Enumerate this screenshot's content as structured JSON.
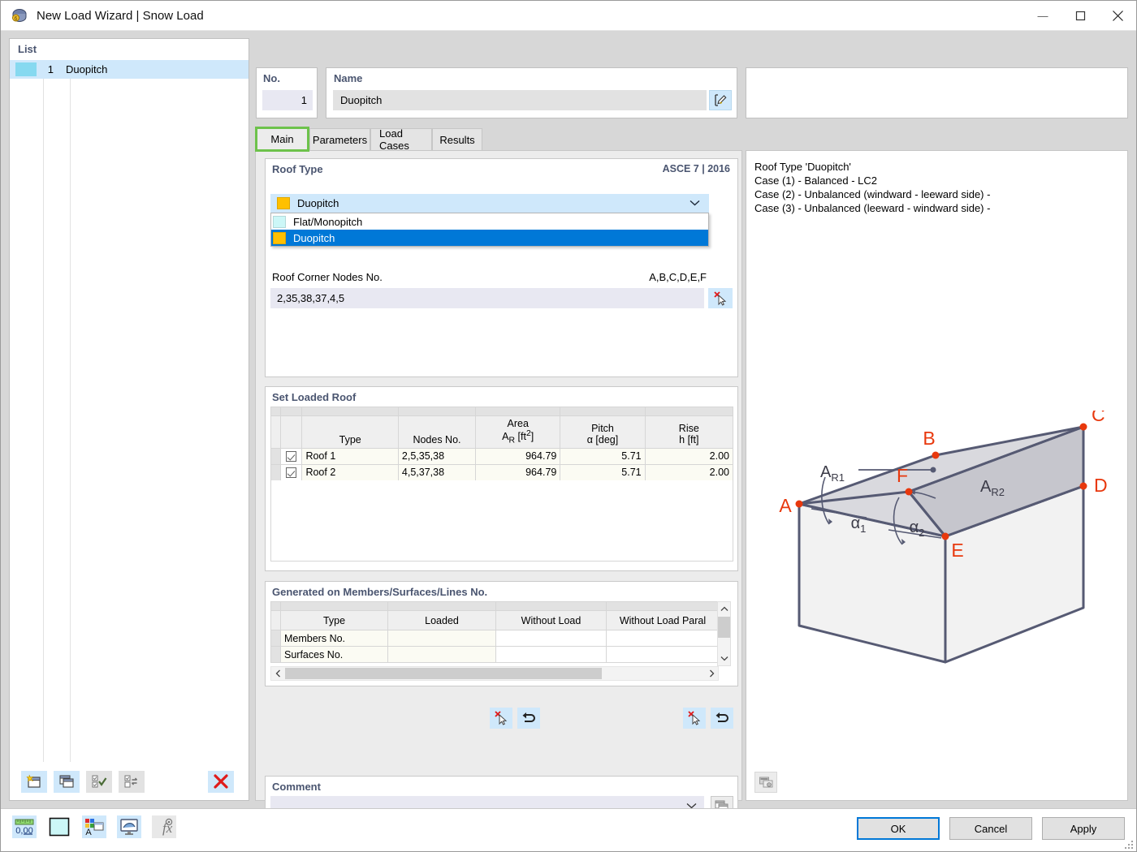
{
  "window": {
    "title": "New Load Wizard | Snow Load",
    "app_icon": "load-wizard-icon",
    "minimize": "—",
    "maximize": "□",
    "close": "✕"
  },
  "list_panel": {
    "caption": "List",
    "rows": [
      {
        "color": "#86d9f0",
        "no": "1",
        "name": "Duopitch"
      }
    ],
    "toolbar": [
      {
        "name": "new-item-button",
        "icon": "new-window-icon"
      },
      {
        "name": "copy-item-button",
        "icon": "copy-window-icon"
      },
      {
        "name": "select-all-button",
        "icon": "check-all-icon"
      },
      {
        "name": "invert-selection-button",
        "icon": "invert-check-icon"
      },
      {
        "name": "delete-item-button",
        "icon": "red-x-icon"
      }
    ]
  },
  "no_panel": {
    "caption": "No.",
    "value": "1"
  },
  "name_panel": {
    "caption": "Name",
    "value": "Duopitch",
    "edit_icon": "edit-pencil-icon"
  },
  "tabs": [
    {
      "label": "Main",
      "active": true
    },
    {
      "label": "Parameters",
      "active": false
    },
    {
      "label": "Load Cases",
      "active": false
    },
    {
      "label": "Results",
      "active": false
    }
  ],
  "roof_type": {
    "title": "Roof Type",
    "standard": "ASCE 7 | 2016",
    "selected": {
      "label": "Duopitch",
      "color": "#ffc000"
    },
    "options": [
      {
        "label": "Flat/Monopitch",
        "color": "#ccf7f7",
        "selected": false
      },
      {
        "label": "Duopitch",
        "color": "#ffc000",
        "selected": true
      }
    ],
    "nodes_label": "Roof Corner Nodes No.",
    "nodes_hint": "A,B,C,D,E,F",
    "nodes_value": "2,35,38,37,4,5",
    "pick_icon": "pick-cursor-icon"
  },
  "loaded_roof": {
    "title": "Set Loaded Roof",
    "columns": [
      "Type",
      "Nodes No.",
      "Area",
      "Pitch",
      "Rise"
    ],
    "column_units": [
      "",
      "",
      "AR [ft2]",
      "α [deg]",
      "h [ft]"
    ],
    "rows": [
      {
        "checked": true,
        "type": "Roof 1",
        "nodes": "2,5,35,38",
        "area": "964.79",
        "pitch": "5.71",
        "rise": "2.00"
      },
      {
        "checked": true,
        "type": "Roof 2",
        "nodes": "4,5,37,38",
        "area": "964.79",
        "pitch": "5.71",
        "rise": "2.00"
      }
    ]
  },
  "generated": {
    "title": "Generated on Members/Surfaces/Lines No.",
    "columns": [
      "Type",
      "Loaded",
      "Without Load",
      "Without Load Paral"
    ],
    "rows": [
      {
        "type": "Members No.",
        "loaded": "",
        "without": "",
        "parallel": ""
      },
      {
        "type": "Surfaces No.",
        "loaded": "",
        "without": "",
        "parallel": ""
      }
    ],
    "scroll_up": "⌃",
    "scroll_down": "⌄",
    "scroll_left": "‹",
    "scroll_right": "›"
  },
  "action_buttons": {
    "left": [
      {
        "name": "pick-left-button",
        "icon": "pick-cursor-icon"
      },
      {
        "name": "undo-left-button",
        "icon": "undo-arrow-icon"
      }
    ],
    "right": [
      {
        "name": "pick-right-button",
        "icon": "pick-cursor-icon"
      },
      {
        "name": "undo-right-button",
        "icon": "undo-arrow-icon"
      }
    ]
  },
  "comment": {
    "title": "Comment",
    "value": "",
    "arrow": "⌄",
    "button_icon": "copy-window-icon"
  },
  "right_panel": {
    "lines": [
      "Roof Type 'Duopitch'",
      "Case (1) - Balanced - LC2",
      "Case (2) - Unbalanced (windward - leeward side) -",
      "Case (3) - Unbalanced (leeward - windward side) -"
    ],
    "image_icon": "image-copy-icon",
    "diagram": {
      "type": "duopitch-roof-3d",
      "nodes": [
        "A",
        "B",
        "C",
        "D",
        "E",
        "F"
      ],
      "areas": [
        "AR1",
        "AR2"
      ],
      "angles": [
        "α1",
        "α2"
      ],
      "node_color": "#e8380d",
      "edge_color": "#565a73"
    }
  },
  "footer": {
    "icons": [
      {
        "name": "units-button",
        "icon": "ruler-000-icon",
        "label": "0,00"
      },
      {
        "name": "color-swatch-button",
        "icon": "color-swatch-icon"
      },
      {
        "name": "display-properties-button",
        "icon": "display-props-icon"
      },
      {
        "name": "visibility-button",
        "icon": "monitor-icon"
      },
      {
        "name": "formula-button",
        "icon": "fx-icon"
      }
    ],
    "buttons": [
      {
        "label": "OK",
        "default": true
      },
      {
        "label": "Cancel",
        "default": false
      },
      {
        "label": "Apply",
        "default": false
      }
    ]
  }
}
